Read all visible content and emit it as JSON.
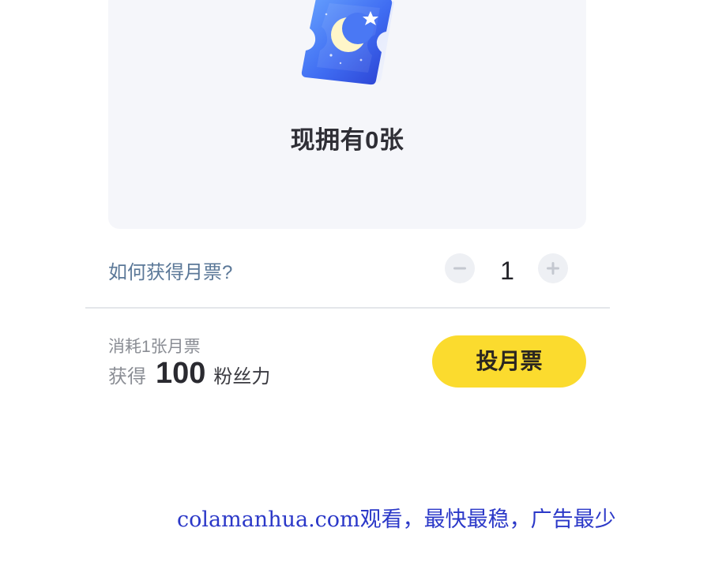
{
  "ticket_card": {
    "owned_text": "现拥有0张",
    "icon": "moon-ticket-icon"
  },
  "howto": {
    "link_text": "如何获得月票?"
  },
  "stepper": {
    "minus_icon": "minus-icon",
    "quantity": "1",
    "plus_icon": "plus-icon"
  },
  "summary": {
    "consume_text": "消耗1张月票",
    "gain_prefix": "获得",
    "gain_amount": "100",
    "gain_suffix": "粉丝力"
  },
  "vote_button": {
    "label": "投月票"
  },
  "watermark": {
    "text": "colamanhua.com观看，最快最稳，广告最少"
  },
  "colors": {
    "accent_yellow": "#fbdb2e",
    "link_blue_gray": "#5b7898",
    "watermark_blue": "#2b38c8",
    "card_background": "#f5f6fa"
  }
}
